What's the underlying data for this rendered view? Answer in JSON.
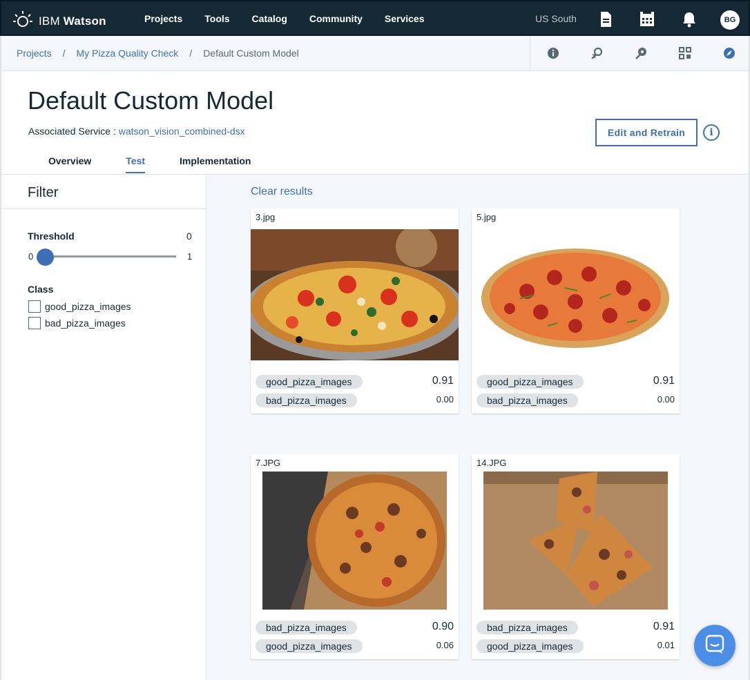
{
  "brand": {
    "prefix": "IBM",
    "name": "Watson"
  },
  "nav": {
    "items": [
      "Projects",
      "Tools",
      "Catalog",
      "Community",
      "Services"
    ],
    "region": "US South",
    "avatar_initials": "BG"
  },
  "breadcrumb": {
    "items": [
      "Projects",
      "My Pizza Quality Check",
      "Default Custom Model"
    ],
    "separator": "/"
  },
  "header": {
    "title": "Default Custom Model",
    "associated_label": "Associated Service :",
    "associated_service": "watson_vision_combined-dsx",
    "edit_button": "Edit and Retrain",
    "info_glyph": "i"
  },
  "tabs": [
    {
      "label": "Overview"
    },
    {
      "label": "Test",
      "active": true
    },
    {
      "label": "Implementation"
    }
  ],
  "filter": {
    "title": "Filter",
    "threshold_label": "Threshold",
    "threshold_value": "0",
    "threshold_min": "0",
    "threshold_max": "1",
    "class_label": "Class",
    "classes": [
      "good_pizza_images",
      "bad_pizza_images"
    ]
  },
  "results": {
    "clear_label": "Clear results",
    "cards": [
      {
        "name": "3.jpg",
        "image": "pizza-photo-icon",
        "scores": [
          {
            "label": "good_pizza_images",
            "value": "0.91"
          },
          {
            "label": "bad_pizza_images",
            "value": "0.00"
          }
        ]
      },
      {
        "name": "5.jpg",
        "image": "pizza-photo-icon",
        "scores": [
          {
            "label": "good_pizza_images",
            "value": "0.91"
          },
          {
            "label": "bad_pizza_images",
            "value": "0.00"
          }
        ]
      },
      {
        "name": "7.JPG",
        "image": "pizza-photo-icon",
        "scores": [
          {
            "label": "bad_pizza_images",
            "value": "0.90"
          },
          {
            "label": "good_pizza_images",
            "value": "0.06"
          }
        ]
      },
      {
        "name": "14.JPG",
        "image": "pizza-photo-icon",
        "scores": [
          {
            "label": "bad_pizza_images",
            "value": "0.91"
          },
          {
            "label": "good_pizza_images",
            "value": "0.01"
          }
        ]
      }
    ]
  },
  "colors": {
    "nav_bg": "#152935",
    "accent": "#3d70b2",
    "tag_bg": "#dfe3e6",
    "chat_fab": "#4c8ee6"
  },
  "icons": [
    "watson-logo-icon",
    "document-icon",
    "calendar-icon",
    "bell-icon",
    "info-icon",
    "reset-icon",
    "pin-icon",
    "qr-grid-icon",
    "compass-icon",
    "chat-icon"
  ]
}
